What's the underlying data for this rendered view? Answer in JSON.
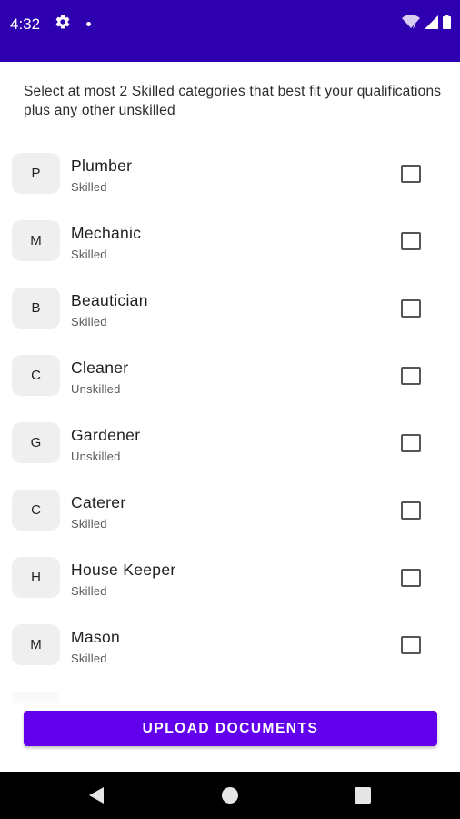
{
  "status_bar": {
    "time": "4:32",
    "background_color": "#2e00b0",
    "icons": [
      "gear-icon",
      "notification-dot-icon",
      "wifi-icon",
      "signal-icon",
      "battery-icon"
    ]
  },
  "instructions": "Select at most 2 Skilled categories that best fit your qualifications plus any other unskilled",
  "categories": [
    {
      "initial": "P",
      "name": "Plumber",
      "type": "Skilled",
      "checked": false
    },
    {
      "initial": "M",
      "name": "Mechanic",
      "type": "Skilled",
      "checked": false
    },
    {
      "initial": "B",
      "name": "Beautician",
      "type": "Skilled",
      "checked": false
    },
    {
      "initial": "C",
      "name": "Cleaner",
      "type": "Unskilled",
      "checked": false
    },
    {
      "initial": "G",
      "name": "Gardener",
      "type": "Unskilled",
      "checked": false
    },
    {
      "initial": "C",
      "name": "Caterer",
      "type": "Skilled",
      "checked": false
    },
    {
      "initial": "H",
      "name": "House Keeper",
      "type": "Skilled",
      "checked": false
    },
    {
      "initial": "M",
      "name": "Mason",
      "type": "Skilled",
      "checked": false
    }
  ],
  "upload_button": {
    "label": "UPLOAD DOCUMENTS",
    "color": "#6200ee"
  },
  "nav_bar": {
    "icons": [
      "back-icon",
      "home-icon",
      "recents-icon"
    ]
  }
}
